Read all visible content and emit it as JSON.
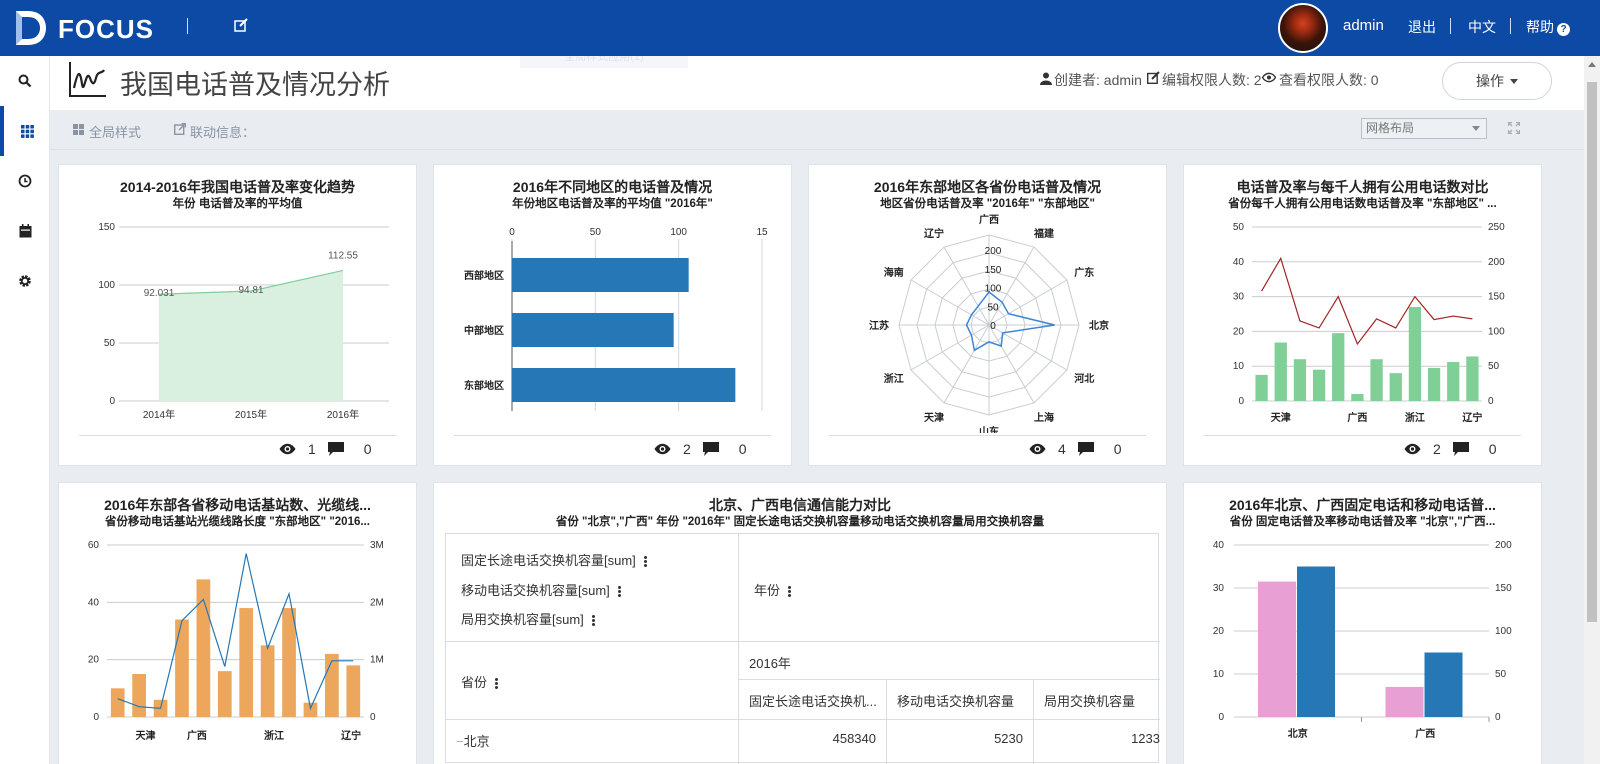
{
  "brand": "FOCUS",
  "top": {
    "user": "admin",
    "logout": "退出",
    "language": "中文",
    "help": "帮助"
  },
  "page": {
    "title": "我国电话普及情况分析",
    "creator_label": "创建者: admin",
    "edit_perm": "编辑权限人数: 2",
    "view_perm": "查看权限人数: 0",
    "op_button": "操作",
    "ghost": "全局样式应用(1)"
  },
  "toolbar": {
    "global_style": "全局样式",
    "linkage": "联动信息：",
    "layout": "网格布局"
  },
  "panels": [
    {
      "title": "2014-2016年我国电话普及率变化趋势",
      "subtitle": "年份 电话普及率的平均值",
      "views": "1",
      "comments": "0"
    },
    {
      "title": "2016年不同地区的电话普及情况",
      "subtitle": "年份地区电话普及率的平均值 \"2016年\"",
      "views": "2",
      "comments": "0"
    },
    {
      "title": "2016年东部地区各省份电话普及情况",
      "subtitle": "地区省份电话普及率 \"2016年\" \"东部地区\"",
      "views": "4",
      "comments": "0"
    },
    {
      "title": "电话普及率与每千人拥有公用电话数对比",
      "subtitle": "省份每千人拥有公用电话数电话普及率 \"东部地区\" ...",
      "views": "2",
      "comments": "0"
    },
    {
      "title": "2016年东部各省移动电话基站数、光缆线...",
      "subtitle": "省份移动电话基站光缆线路长度 \"东部地区\" \"2016...",
      "views": "",
      "comments": ""
    },
    {
      "title": "北京、广西电信通信能力对比",
      "subtitle": "省份 \"北京\",\"广西\" 年份 \"2016年\" 固定长途电话交换机容量移动电话交换机容量局用交换机容量",
      "views": "",
      "comments": ""
    },
    {
      "title": "2016年北京、广西固定电话和移动电话普...",
      "subtitle": "省份 固定电话普及率移动电话普及率 \"北京\",\"广西...",
      "views": "",
      "comments": ""
    }
  ],
  "pivot": {
    "measures": [
      "固定长途电话交换机容量[sum]",
      "移动电话交换机容量[sum]",
      "局用交换机容量[sum]"
    ],
    "col_dim": "年份",
    "row_dim": "省份",
    "year": "2016年",
    "cols": [
      "固定长途电话交换机...",
      "移动电话交换机容量",
      "局用交换机容量"
    ],
    "rows": [
      {
        "name": "北京",
        "values": [
          "458340",
          "5230",
          "1233"
        ]
      }
    ]
  },
  "chart_data": [
    {
      "type": "area",
      "title": "2014-2016年我国电话普及率变化趋势",
      "subtitle": "年份 电话普及率的平均值",
      "categories": [
        "2014年",
        "2015年",
        "2016年"
      ],
      "values": [
        92.031,
        94.81,
        112.55
      ],
      "labels": [
        "92.031",
        "94.81",
        "112.55"
      ],
      "yticks": [
        "0",
        "50",
        "100",
        "150"
      ],
      "ylim": [
        0,
        150
      ],
      "grid": true,
      "colors": {
        "fill": "#d9f0e0",
        "line": "#7fcf97"
      }
    },
    {
      "type": "bar",
      "orientation": "horizontal",
      "title": "2016年不同地区的电话普及情况",
      "subtitle": "年份地区电话普及率的平均值 \"2016年\"",
      "categories": [
        "西部地区",
        "中部地区",
        "东部地区"
      ],
      "values": [
        106,
        97,
        134
      ],
      "xticks": [
        "0",
        "50",
        "100",
        "15"
      ],
      "xlim": [
        0,
        150
      ],
      "colors": {
        "bar": "#2577b5"
      }
    },
    {
      "type": "radar",
      "title": "2016年东部地区各省份电话普及情况",
      "subtitle": "地区省份电话普及率 \"2016年\" \"东部地区\"",
      "categories": [
        "广西",
        "福建",
        "广东",
        "北京",
        "河北",
        "上海",
        "山东",
        "天津",
        "浙江",
        "江苏",
        "海南",
        "辽宁"
      ],
      "values": [
        88,
        70,
        60,
        175,
        42,
        65,
        45,
        78,
        54,
        60,
        54,
        58
      ],
      "rticks": [
        "0",
        "50",
        "100",
        "150",
        "200"
      ],
      "rlim": [
        0,
        240
      ],
      "colors": {
        "line": "#3d85d8"
      }
    },
    {
      "type": "bar+line",
      "title": "电话普及率与每千人拥有公用电话数对比",
      "subtitle": "省份每千人拥有公用电话数电话普及率 \"东部地区\" ...",
      "categories": [
        "",
        "天津",
        "",
        "",
        "",
        "广西",
        "",
        "",
        "浙江",
        "",
        "",
        "辽宁"
      ],
      "series": [
        {
          "values": [
            7.5,
            16.8,
            12,
            9,
            19.5,
            2,
            12,
            8,
            27,
            9.5,
            11.2,
            12.8
          ],
          "color": "#7fcf97"
        },
        {
          "values": [
            158,
            205,
            115,
            105,
            150,
            82,
            118,
            105,
            150,
            117,
            122,
            118
          ],
          "color": "#a32222"
        }
      ],
      "yticks_left": [
        "0",
        "10",
        "20",
        "30",
        "40",
        "50"
      ],
      "yticks_right": [
        "0",
        "50",
        "100",
        "150",
        "200",
        "250"
      ],
      "ylim_left": [
        0,
        50
      ],
      "ylim_right": [
        0,
        250
      ]
    },
    {
      "type": "bar+line",
      "title": "2016年东部各省移动电话基站数、光缆线...",
      "subtitle": "省份移动电话基站光缆线路长度 \"东部地区\" \"2016...",
      "categories": [
        "",
        "天津",
        "",
        "广西",
        "",
        "",
        "浙江",
        "",
        "",
        "辽宁"
      ],
      "series": [
        {
          "values": [
            10,
            15,
            6,
            34,
            48,
            16,
            38,
            25,
            38,
            5,
            22,
            18
          ],
          "color": "#eda75c"
        },
        {
          "values": [
            0.32,
            0.18,
            0.15,
            1.68,
            2.05,
            0.88,
            2.85,
            1.2,
            2.15,
            0.15,
            0.98,
            0.98
          ],
          "color": "#2577b5"
        }
      ],
      "yticks_left": [
        "0",
        "20",
        "40",
        "60"
      ],
      "yticks_right": [
        "0",
        "1M",
        "2M",
        "3M"
      ],
      "ylim_left": [
        0,
        60
      ],
      "ylim_right": [
        0,
        3
      ]
    },
    {
      "type": "bar",
      "title": "2016年北京、广西固定电话和移动电话普...",
      "subtitle": "省份 固定电话普及率移动电话普及率 \"北京\",\"广西...",
      "categories": [
        "北京",
        "广西"
      ],
      "series": [
        {
          "values": [
            31.5,
            7
          ],
          "color": "#e89fd3"
        },
        {
          "values": [
            35,
            15
          ],
          "color": "#2577b5"
        }
      ],
      "yticks_left": [
        "0",
        "10",
        "20",
        "30",
        "40"
      ],
      "yticks_right": [
        "0",
        "50",
        "100",
        "150",
        "200"
      ],
      "ylim_left": [
        0,
        40
      ]
    }
  ]
}
